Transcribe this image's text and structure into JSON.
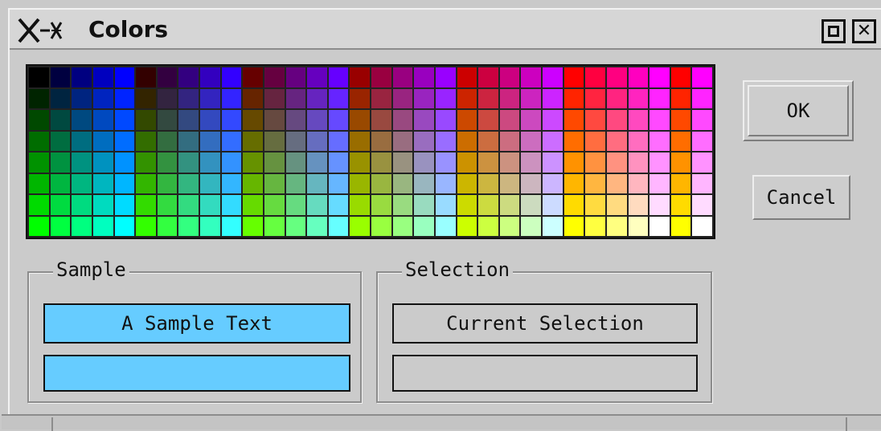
{
  "window": {
    "title": "Colors",
    "logo_icon": "x-window-logo-icon",
    "maximize_icon": "maximize-icon",
    "close_icon": "close-icon",
    "close_glyph": "✕"
  },
  "palette": {
    "rows": 8,
    "cols": 32,
    "description_of_levels": {
      "red_levels": [
        0,
        51,
        102,
        153,
        204,
        255
      ],
      "green_levels_rows": [
        0,
        36,
        73,
        109,
        146,
        182,
        219,
        255
      ],
      "blue_levels": [
        0,
        64,
        128,
        191,
        255
      ]
    }
  },
  "buttons": {
    "ok_label": "OK",
    "cancel_label": "Cancel"
  },
  "sample": {
    "group_label": "Sample",
    "text": "A Sample Text",
    "color": "#66ccff"
  },
  "selection": {
    "group_label": "Selection",
    "text": "Current Selection",
    "color": "#cbcbcb"
  }
}
